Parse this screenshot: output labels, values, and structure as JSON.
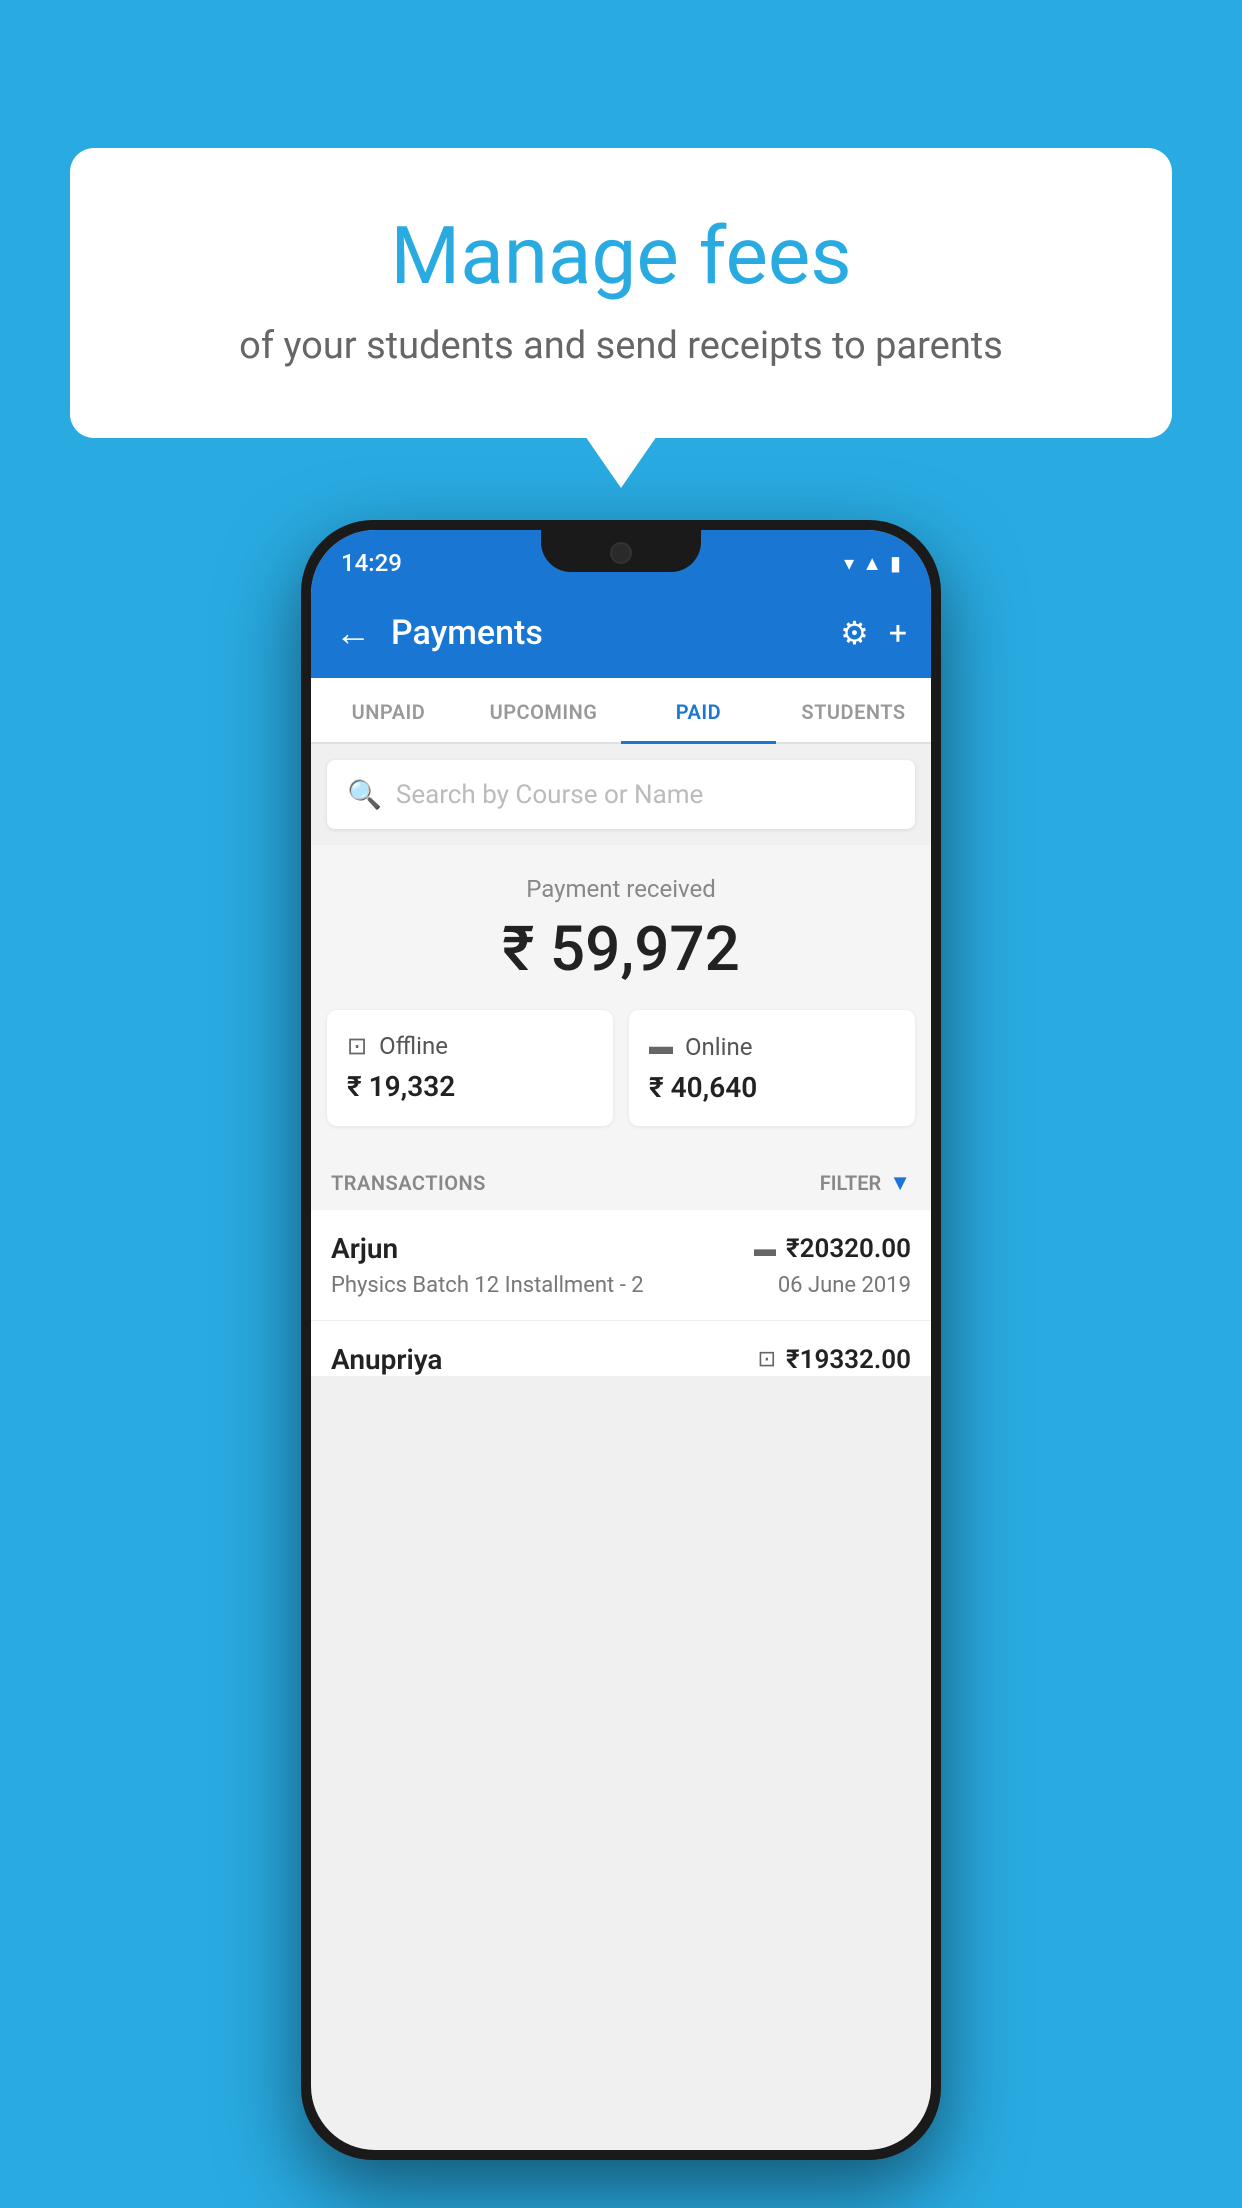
{
  "background_color": "#29abe2",
  "bubble": {
    "title": "Manage fees",
    "subtitle": "of your students and send receipts to parents"
  },
  "status_bar": {
    "time": "14:29",
    "icons": [
      "wifi",
      "signal",
      "battery"
    ]
  },
  "header": {
    "title": "Payments",
    "back_label": "←",
    "settings_label": "⚙",
    "add_label": "+"
  },
  "tabs": [
    {
      "id": "unpaid",
      "label": "UNPAID",
      "active": false
    },
    {
      "id": "upcoming",
      "label": "UPCOMING",
      "active": false
    },
    {
      "id": "paid",
      "label": "PAID",
      "active": true
    },
    {
      "id": "students",
      "label": "STUDENTS",
      "active": false
    }
  ],
  "search": {
    "placeholder": "Search by Course or Name"
  },
  "payment_summary": {
    "label": "Payment received",
    "amount": "₹ 59,972",
    "offline": {
      "icon": "💳",
      "label": "Offline",
      "amount": "₹ 19,332"
    },
    "online": {
      "icon": "💳",
      "label": "Online",
      "amount": "₹ 40,640"
    }
  },
  "transactions": {
    "label": "TRANSACTIONS",
    "filter_label": "FILTER",
    "items": [
      {
        "name": "Arjun",
        "course": "Physics Batch 12 Installment - 2",
        "amount": "₹20320.00",
        "date": "06 June 2019",
        "payment_method": "card"
      },
      {
        "name": "Anupriya",
        "course": "",
        "amount": "₹19332.00",
        "date": "",
        "payment_method": "cash"
      }
    ]
  }
}
